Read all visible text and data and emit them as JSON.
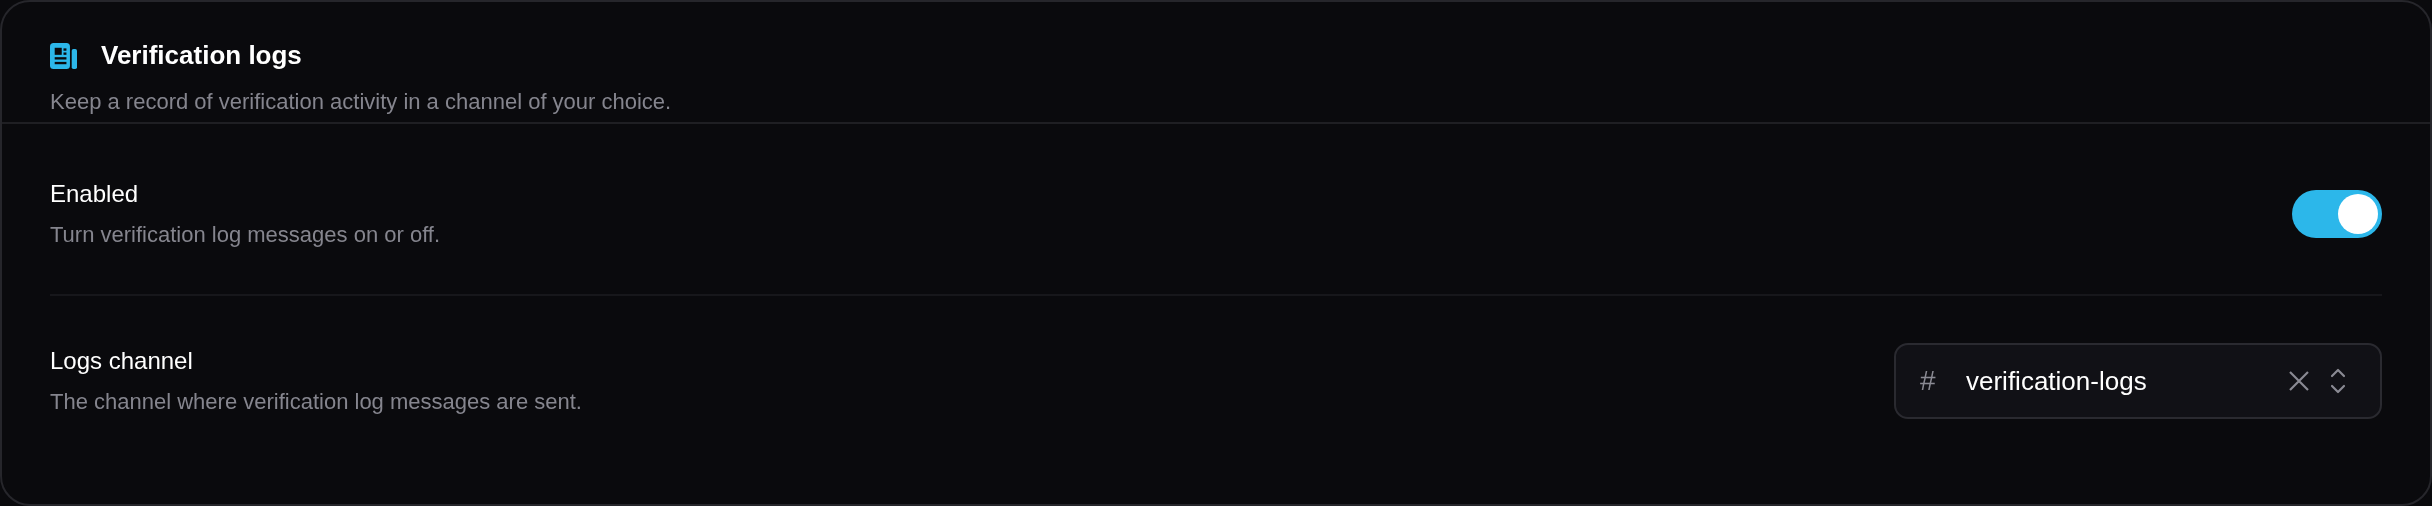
{
  "section": {
    "title": "Verification logs",
    "description": "Keep a record of verification activity in a channel of your choice."
  },
  "settings": [
    {
      "kind": "toggle",
      "label": "Enabled",
      "description": "Turn verification log messages on or off.",
      "on": true
    },
    {
      "kind": "select",
      "label": "Logs channel",
      "description": "The channel where verification log messages are sent.",
      "prefix": "#",
      "value": "verification-logs"
    }
  ]
}
